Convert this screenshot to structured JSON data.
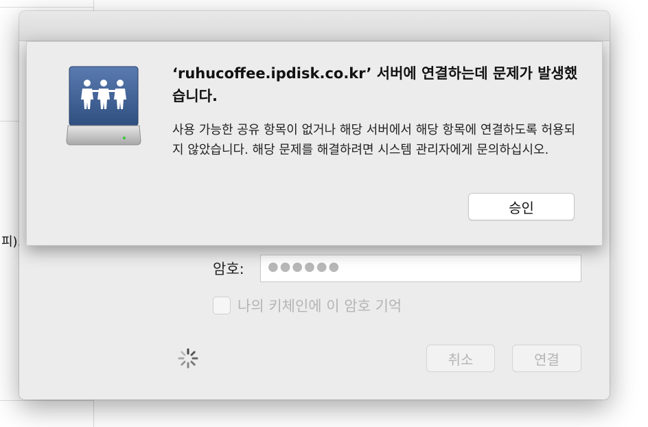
{
  "background": {
    "fragment_text": "피)."
  },
  "login_dialog": {
    "password_label": "암호:",
    "password_value": "●●●●●●",
    "remember_label": "나의 키체인에 이 암호 기억",
    "cancel_label": "취소",
    "connect_label": "연결",
    "spinner_icon": "spinner-icon"
  },
  "error_sheet": {
    "icon": "network-server-icon",
    "title": "‘ruhucoffee.ipdisk.co.kr’ 서버에 연결하는데 문제가 발생했습니다.",
    "message": "사용 가능한 공유 항목이 없거나 해당 서버에서 해당 항목에 연결하도록 허용되지 않았습니다. 해당 문제를 해결하려면 시스템 관리자에게 문의하십시오.",
    "approve_label": "승인"
  },
  "colors": {
    "server_icon_blue": "#3b5d8f",
    "window_bg": "#ececec"
  }
}
